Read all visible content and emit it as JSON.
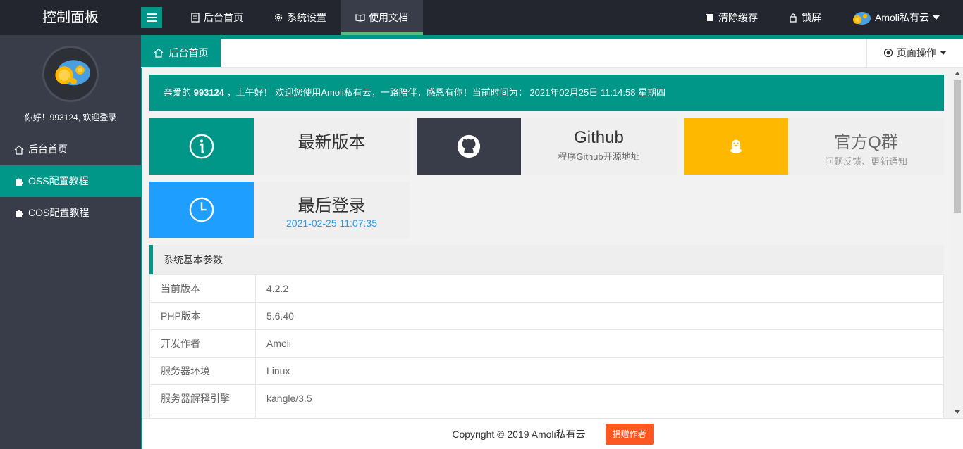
{
  "header": {
    "logo": "控制面板",
    "nav": [
      {
        "label": "后台首页",
        "icon": "document-icon"
      },
      {
        "label": "系统设置",
        "icon": "gear-icon"
      },
      {
        "label": "使用文档",
        "icon": "book-icon"
      }
    ],
    "right": {
      "clear_cache": "清除缓存",
      "lock": "锁屏",
      "user": "Amoli私有云"
    }
  },
  "sidebar": {
    "welcome": "你好！993124, 欢迎登录",
    "items": [
      {
        "label": "后台首页",
        "icon": "home-icon"
      },
      {
        "label": "OSS配置教程",
        "icon": "puzzle-icon"
      },
      {
        "label": "COS配置教程",
        "icon": "puzzle-icon"
      }
    ]
  },
  "tabs": {
    "home": "后台首页",
    "page_ops": "页面操作"
  },
  "notice": {
    "prefix": "亲爱的",
    "user": "993124",
    "text": "，上午好！ 欢迎您使用Amoli私有云，一路陪伴，感恩有你！当前时间为： 2021年02月25日 11:14:58 星期四"
  },
  "cards": {
    "latest": {
      "title": "最新版本",
      "sub": ""
    },
    "github": {
      "title": "Github",
      "sub": "程序Github开源地址"
    },
    "qq": {
      "title": "官方Q群",
      "sub": "问题反馈、更新通知"
    },
    "login": {
      "title": "最后登录",
      "sub": "2021-02-25 11:07:35"
    }
  },
  "colors": {
    "teal": "#009688",
    "dark": "#393d49",
    "yellow": "#ffb800",
    "blue": "#1e9fff",
    "orange": "#ff5722"
  },
  "params": {
    "title": "系统基本参数",
    "rows": [
      {
        "k": "当前版本",
        "v": "4.2.2"
      },
      {
        "k": "PHP版本",
        "v": "5.6.40"
      },
      {
        "k": "开发作者",
        "v": "Amoli"
      },
      {
        "k": "服务器环境",
        "v": "Linux"
      },
      {
        "k": "服务器解释引擎",
        "v": "kangle/3.5"
      }
    ]
  },
  "footer": {
    "copyright": "Copyright © 2019 Amoli私有云",
    "donate": "捐赠作者"
  }
}
